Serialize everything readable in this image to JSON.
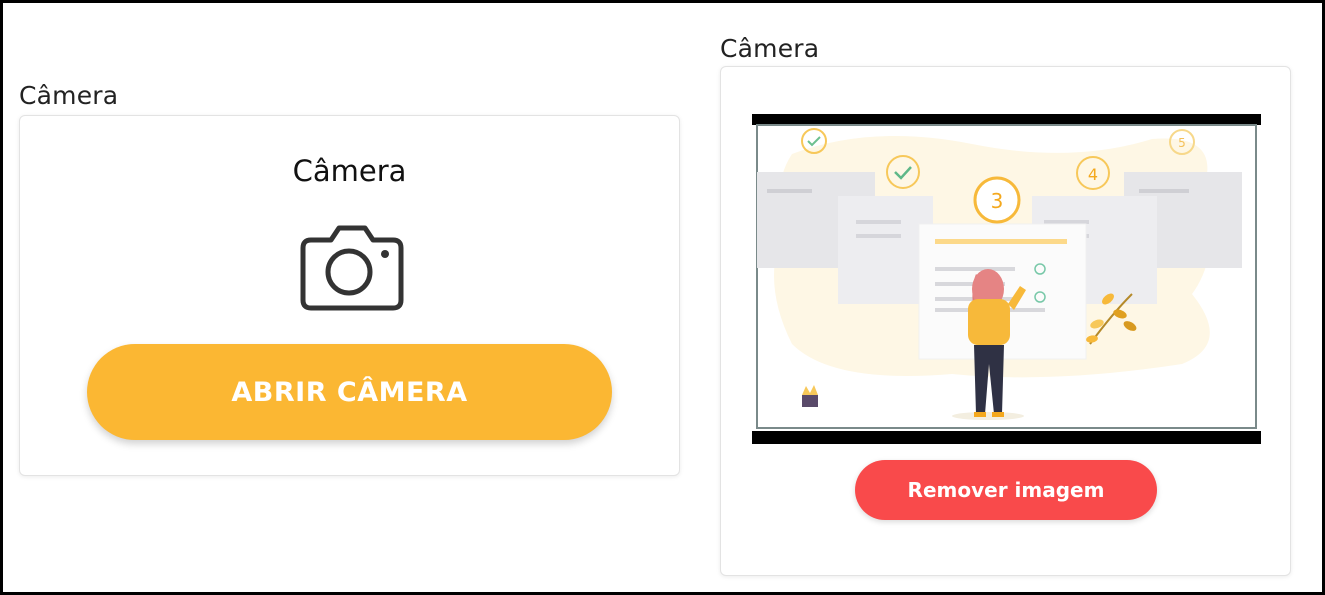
{
  "left": {
    "section_label": "Câmera",
    "card_title": "Câmera",
    "open_button": "ABRIR CÂMERA",
    "icon": "camera-icon"
  },
  "right": {
    "section_label": "Câmera",
    "preview_icon": "checklist-illustration",
    "illustration_step_numbers": [
      "3",
      "4",
      "5"
    ],
    "remove_button": "Remover imagem"
  },
  "colors": {
    "primary_button": "#fbb733",
    "danger_button": "#f94a4b"
  }
}
